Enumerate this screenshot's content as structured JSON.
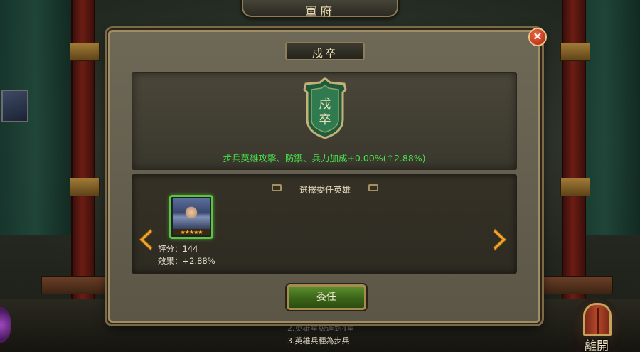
{
  "window_title": "軍府",
  "dialog": {
    "title": "戍卒",
    "badge_text": [
      "戍",
      "卒"
    ],
    "effect_text": "步兵英雄攻擊、防禦、兵力加成+0.00%(↑2.88%)",
    "section_header": "選擇委任英雄",
    "hero": {
      "stars": "★★★★★",
      "score": "評分：144",
      "effect": "效果：+2.88%"
    },
    "appoint_label": "委任",
    "close_symbol": "×"
  },
  "tips": {
    "tip2": "2.英雄星級達到4星",
    "tip3": "3.英雄兵種為步兵"
  },
  "exit_label": "離開",
  "colors": {
    "effect_green": "#47e24a",
    "hero_border": "#5cc43d",
    "button_green": "#3a6418",
    "close_red": "#a81f10",
    "frame_gold": "#a08d63"
  },
  "icons": {
    "left_arrow": "chevron-left-icon",
    "right_arrow": "chevron-right-icon",
    "close": "close-icon",
    "exit": "door-icon"
  }
}
